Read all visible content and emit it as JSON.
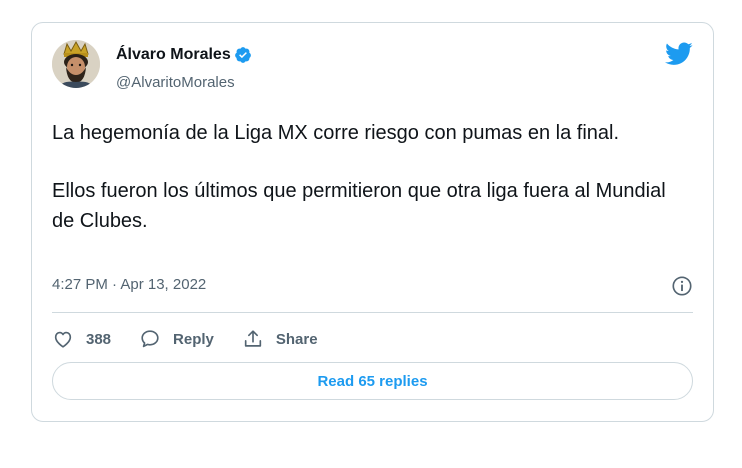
{
  "author": {
    "name": "Álvaro Morales",
    "handle": "@AlvaritoMorales",
    "verified": true,
    "avatar_icon": "avatar-crowned-man"
  },
  "tweet": {
    "paragraphs": [
      "La hegemonía de la Liga MX corre riesgo con pumas en la final.",
      "Ellos fueron los últimos que permitieron que otra liga fuera al Mundial de Clubes."
    ],
    "timestamp": "4:27 PM · Apr 13, 2022"
  },
  "actions": {
    "likes": "388",
    "reply_label": "Reply",
    "share_label": "Share"
  },
  "read_replies_label": "Read 65 replies",
  "icons": {
    "brand": "twitter-bird-icon",
    "info": "info-icon",
    "like": "heart-icon",
    "reply": "speech-bubble-icon",
    "share": "share-icon",
    "verified": "verified-badge-icon"
  },
  "colors": {
    "accent": "#1d9bf0",
    "text": "#0f1419",
    "muted": "#536471",
    "border": "#cfd9de"
  }
}
